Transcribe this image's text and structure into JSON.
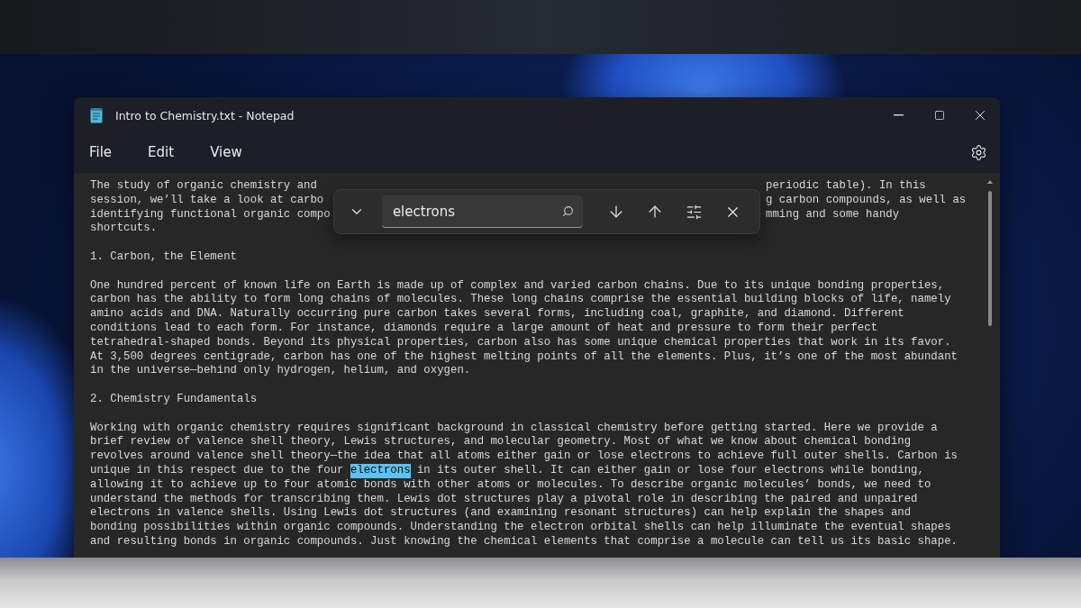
{
  "window": {
    "title": "Intro to Chemistry.txt - Notepad"
  },
  "menu": [
    {
      "label": "File"
    },
    {
      "label": "Edit"
    },
    {
      "label": "View"
    }
  ],
  "find_bar": {
    "value": "electrons"
  },
  "document": {
    "paragraphs": [
      {
        "lines": [
          {
            "text": "The study of organic chemistry and",
            "right": "periodic table). In this"
          },
          {
            "text": "session, we’ll take a look at carbo",
            "right": "g carbon compounds, as well as"
          },
          {
            "text": "identifying functional organic compo",
            "right": "mming and some handy"
          },
          {
            "text": "shortcuts."
          }
        ]
      },
      {
        "lines": [
          {
            "text": "1. Carbon, the Element"
          }
        ]
      },
      {
        "lines": [
          {
            "text": "One hundred percent of known life on Earth is made up of complex and varied carbon chains. Due to its unique bonding properties,"
          },
          {
            "text": "carbon has the ability to form long chains of molecules. These long chains comprise the essential building blocks of life, namely"
          },
          {
            "text": "amino acids and DNA. Naturally occurring pure carbon takes several forms, including coal, graphite, and diamond. Different"
          },
          {
            "text": "conditions lead to each form. For instance, diamonds require a large amount of heat and pressure to form their perfect"
          },
          {
            "text": "tetrahedral-shaped bonds. Beyond its physical properties, carbon also has some unique chemical properties that work in its favor."
          },
          {
            "text": "At 3,500 degrees centigrade, carbon has one of the highest melting points of all the elements. Plus, it’s one of the most abundant"
          },
          {
            "text": "in the universe—behind only hydrogen, helium, and oxygen."
          }
        ]
      },
      {
        "lines": [
          {
            "text": "2. Chemistry Fundamentals"
          }
        ]
      },
      {
        "lines": [
          {
            "text": "Working with organic chemistry requires significant background in classical chemistry before getting started. Here we provide a"
          },
          {
            "text": "brief review of valence shell theory, Lewis structures, and molecular geometry. Most of what we know about chemical bonding"
          },
          {
            "text": "revolves around valence shell theory—the idea that all atoms either gain or lose electrons to achieve full outer shells. Carbon is"
          },
          {
            "text": "unique in this respect due to the four",
            "match": "electrons",
            "after": "in its outer shell. It can either gain or lose four electrons while bonding,"
          },
          {
            "text": "allowing it to achieve up to four atomic bonds with other atoms or molecules. To describe organic molecules’ bonds, we need to"
          },
          {
            "text": "understand the methods for transcribing them. Lewis dot structures play a pivotal role in describing the paired and unpaired"
          },
          {
            "text": "electrons in valence shells. Using Lewis dot structures (and examining resonant structures) can help explain the shapes and"
          },
          {
            "text": "bonding possibilities within organic compounds. Understanding the electron orbital shells can help illuminate the eventual shapes"
          },
          {
            "text": "and resulting bonds in organic compounds. Just knowing the chemical elements that comprise a molecule can tell us its basic shape."
          }
        ]
      }
    ]
  }
}
